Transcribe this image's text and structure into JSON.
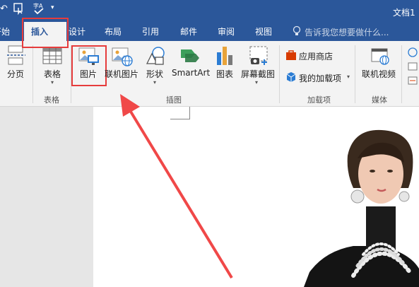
{
  "title_bar": {
    "doc_title": "文档1",
    "quick_access": [
      "undo-icon",
      "touch-mode-icon",
      "spelling-icon"
    ]
  },
  "tabs": [
    {
      "label": "开始",
      "active": false
    },
    {
      "label": "插入",
      "active": true
    },
    {
      "label": "设计",
      "active": false
    },
    {
      "label": "布局",
      "active": false
    },
    {
      "label": "引用",
      "active": false
    },
    {
      "label": "邮件",
      "active": false
    },
    {
      "label": "审阅",
      "active": false
    },
    {
      "label": "视图",
      "active": false
    }
  ],
  "tell_me": {
    "placeholder": "告诉我您想要做什么..."
  },
  "ribbon": {
    "pages": {
      "page_break_label": "分页"
    },
    "table": {
      "table_label": "表格",
      "group": "表格"
    },
    "illustrations": {
      "picture_label": "图片",
      "online_picture_label": "联机图片",
      "shapes_label": "形状",
      "smartart_label": "SmartArt",
      "chart_label": "图表",
      "screenshot_label": "屏幕截图",
      "group": "插图"
    },
    "addins": {
      "store_label": "应用商店",
      "my_addins_label": "我的加载项",
      "group": "加载项"
    },
    "media": {
      "online_video_label": "联机视频",
      "group": "媒体"
    }
  },
  "colors": {
    "brand": "#2b579a",
    "highlight": "#e63c3c"
  }
}
